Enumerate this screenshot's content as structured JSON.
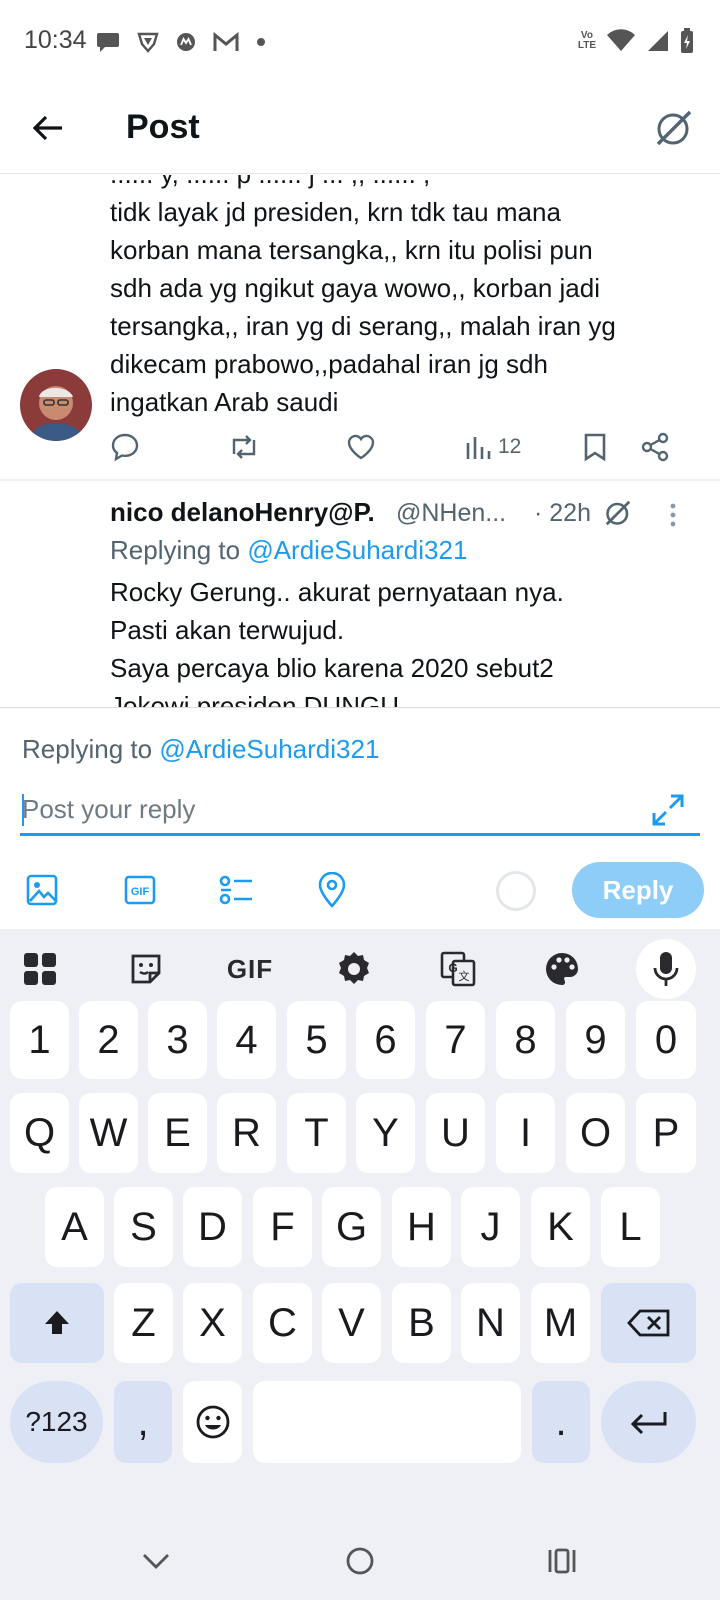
{
  "status_bar": {
    "time": "10:34",
    "left_icons": [
      "chat-icon",
      "vpn-shield-icon",
      "motorola-icon",
      "gmail-icon",
      "dot-icon"
    ],
    "right_icons": [
      "volte-icon",
      "wifi-icon",
      "cell-signal-icon",
      "battery-charging-icon"
    ],
    "volte_top": "Vo",
    "volte_bottom": "LTE"
  },
  "header": {
    "title": "Post"
  },
  "tweet1": {
    "text_lines": [
      "...... y, ...... p ...... j ... ,, ...... ,",
      "tidk layak jd presiden, krn tdk tau mana",
      "korban mana tersangka,, krn itu polisi pun",
      "sdh ada yg ngikut gaya wowo,, korban jadi",
      "tersangka,, iran yg di serang,, malah iran yg",
      "dikecam prabowo,,padahal iran jg sdh",
      "ingatkan Arab saudi"
    ],
    "views": "12"
  },
  "tweet2": {
    "name": "nico delanoHenry@P.",
    "handle": "@NHen...",
    "time": "· 22h",
    "replying_prefix": "Replying to ",
    "replying_to": "@ArdieSuhardi321",
    "text_lines": [
      "Rocky Gerung.. akurat  pernyataan nya.",
      "Pasti  akan  terwujud.",
      "Saya  percaya  blio  karena  2020 sebut2",
      "Jokowi presiden DUNGU"
    ]
  },
  "composer": {
    "replying_prefix": "Replying to ",
    "replying_to": "@ArdieSuhardi321",
    "placeholder": "Post your reply",
    "reply_label": "Reply"
  },
  "keyboard": {
    "toolbar": [
      "apps-grid-icon",
      "sticker-icon",
      "gif-icon",
      "settings-icon",
      "translate-icon",
      "palette-icon",
      "mic-icon"
    ],
    "gif_label": "GIF",
    "row_numbers": [
      "1",
      "2",
      "3",
      "4",
      "5",
      "6",
      "7",
      "8",
      "9",
      "0"
    ],
    "row_top": [
      "Q",
      "W",
      "E",
      "R",
      "T",
      "Y",
      "U",
      "I",
      "O",
      "P"
    ],
    "row_middle": [
      "A",
      "S",
      "D",
      "F",
      "G",
      "H",
      "J",
      "K",
      "L"
    ],
    "row_bottom": [
      "Z",
      "X",
      "C",
      "V",
      "B",
      "N",
      "M"
    ],
    "symbols_label": "?123",
    "comma": ",",
    "period": "."
  },
  "colors": {
    "accent": "#1d9bf0",
    "reply_button_disabled": "#8ecdf7",
    "keyboard_bg": "#eef0f6",
    "modifier_key": "#d9e2f4",
    "secondary_text": "#536471"
  }
}
